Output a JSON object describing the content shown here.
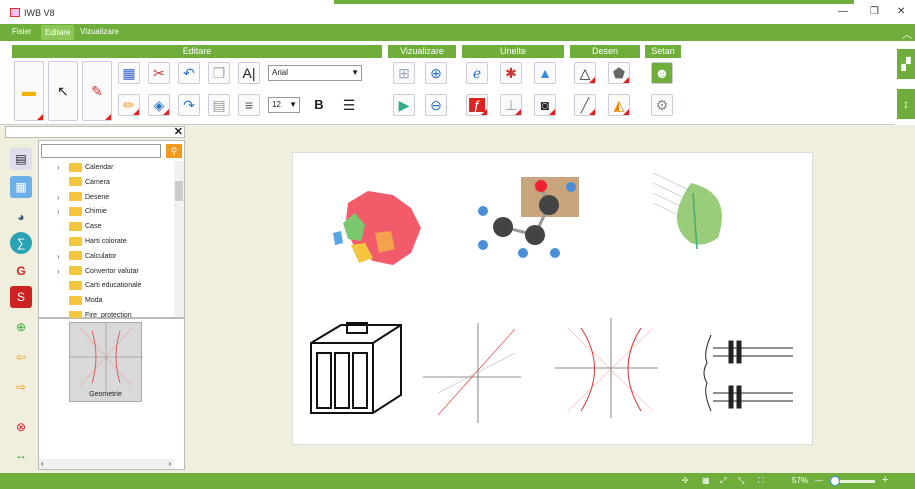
{
  "window": {
    "title": "IWB V8",
    "minimize": "—",
    "restore": "❐",
    "close": "✕"
  },
  "menu": {
    "items": [
      "Fisier",
      "Editare",
      "Vizualizare"
    ]
  },
  "ribbon": {
    "groups": [
      "Editare",
      "Vizualizare",
      "Unelte",
      "Desen",
      "Setari"
    ],
    "font": "Arial",
    "font_size": "12",
    "bold": "B"
  },
  "panel": {
    "tree_items": [
      {
        "label": "Calendar",
        "chevron": true
      },
      {
        "label": "Camera",
        "chevron": false
      },
      {
        "label": "Desene",
        "chevron": true
      },
      {
        "label": "Chimie",
        "chevron": true
      },
      {
        "label": "Case",
        "chevron": false
      },
      {
        "label": "Harti colorate",
        "chevron": false
      },
      {
        "label": "Calculator",
        "chevron": true
      },
      {
        "label": "Convertor valutar",
        "chevron": true
      },
      {
        "label": "Carti educationale",
        "chevron": false
      },
      {
        "label": "Moda",
        "chevron": false
      },
      {
        "label": "Fire_protection",
        "chevron": false
      }
    ],
    "gallery_label": "Geometrie"
  },
  "status": {
    "zoom": "57%",
    "minus": "—",
    "plus": "+"
  },
  "colors": {
    "accent": "#6fae3a",
    "orange": "#f39a1d"
  }
}
